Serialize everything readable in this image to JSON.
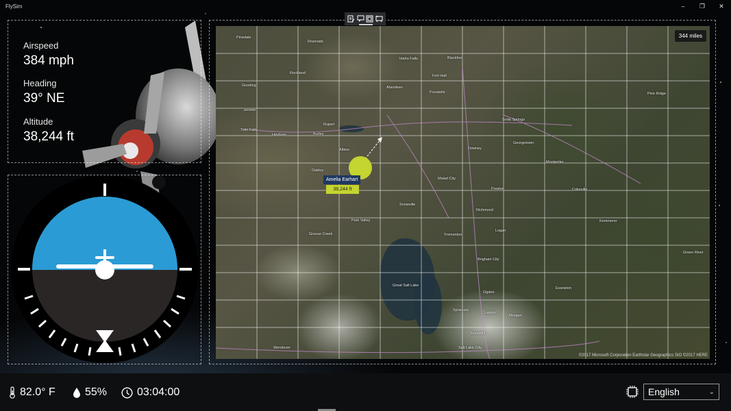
{
  "app": {
    "title": "FlySim"
  },
  "window_controls": {
    "minimize": "–",
    "maximize": "❐",
    "close": "✕"
  },
  "telemetry": {
    "airspeed_label": "Airspeed",
    "airspeed_value": "384 mph",
    "heading_label": "Heading",
    "heading_value": "39° NE",
    "altitude_label": "Altitude",
    "altitude_value": "38,244 ft"
  },
  "map": {
    "toolbar_icons": [
      "layers-icon",
      "chat-icon",
      "frame-icon",
      "traffic-icon"
    ],
    "scale": "344 miles",
    "copyright": "©2017 Microsoft Corporation Earthstar Geographics SIO ©2017 HERE",
    "pin": {
      "name": "Amelia Earhart",
      "altitude": "38,244 ft"
    },
    "labels": [
      "Pinedale",
      "Riverside",
      "Rockland",
      "Idaho Falls",
      "Pocatello",
      "Fort Hall",
      "Aberdeen",
      "Blackfoot",
      "Rupert",
      "Burley",
      "Jerome",
      "Twin Falls",
      "Gooding",
      "Heyburn",
      "Albion",
      "Oakley",
      "Soda Springs",
      "Georgetown",
      "Downey",
      "Preston",
      "Malad City",
      "Richmond",
      "Logan",
      "Tremonton",
      "Snowville",
      "Brigham City",
      "Ogden",
      "Layton",
      "Syracuse",
      "Morgan",
      "Bountiful",
      "Salt Lake City",
      "Park Valley",
      "Grouse Creek",
      "Wendover",
      "Evanston",
      "Green River",
      "Great Salt Lake",
      "Kemmerer",
      "Cokeville",
      "Montpelier",
      "Pine Ridge"
    ]
  },
  "status": {
    "temperature": "82.0° F",
    "humidity": "55%",
    "elapsed_time": "03:04:00",
    "language": "English"
  },
  "colors": {
    "sky": "#2b9bd5",
    "ground": "#2a2625",
    "pin": "#c4d430",
    "pin_label_bg": "#1f3960"
  }
}
